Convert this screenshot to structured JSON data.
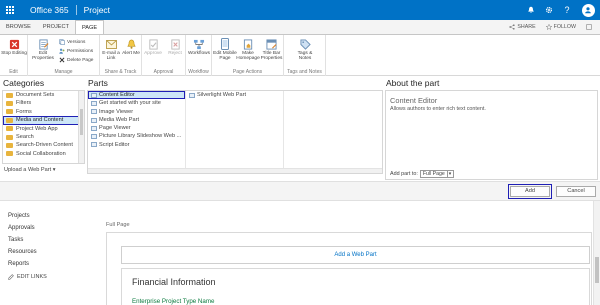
{
  "suite": {
    "brand": "Office 365",
    "app": "Project",
    "avatar_icon": "person-icon"
  },
  "ribbon_tabs": [
    {
      "label": "BROWSE"
    },
    {
      "label": "PROJECT"
    },
    {
      "label": "PAGE",
      "active": true
    }
  ],
  "tab_actions": {
    "share": "SHARE",
    "follow": "FOLLOW"
  },
  "ribbon": {
    "groups": {
      "edit": "Edit",
      "manage": "Manage",
      "share_track": "Share & Track",
      "approval": "Approval",
      "workflow": "Workflow",
      "page_actions": "Page Actions",
      "tags_notes": "Tags and Notes"
    },
    "buttons": {
      "stop_editing": "Stop Editing",
      "edit_properties": "Edit Properties",
      "versions": "Versions",
      "permissions": "Permissions",
      "delete_page": "Delete Page",
      "email_link": "E-mail a Link",
      "alert_me": "Alert Me",
      "approve": "Approve",
      "reject": "Reject",
      "workflows": "Workflows",
      "edit_mobile_page": "Edit Mobile Page",
      "make_homepage": "Make Homepage",
      "title_bar_properties": "Title Bar Properties",
      "tags_notes": "Tags & Notes"
    }
  },
  "adder": {
    "categories_title": "Categories",
    "parts_title": "Parts",
    "about_title": "About the part",
    "categories": [
      {
        "label": "Document Sets"
      },
      {
        "label": "Filters"
      },
      {
        "label": "Forms"
      },
      {
        "label": "Media and Content",
        "selected": true
      },
      {
        "label": "Project Web App"
      },
      {
        "label": "Search"
      },
      {
        "label": "Search-Driven Content"
      },
      {
        "label": "Social Collaboration"
      }
    ],
    "upload": "Upload a Web Part",
    "parts_col1": [
      {
        "label": "Content Editor",
        "selected": true
      },
      {
        "label": "Get started with your site"
      },
      {
        "label": "Image Viewer"
      },
      {
        "label": "Media Web Part"
      },
      {
        "label": "Page Viewer"
      },
      {
        "label": "Picture Library Slideshow Web ..."
      },
      {
        "label": "Script Editor"
      }
    ],
    "parts_col2": [
      {
        "label": "Silverlight Web Part"
      }
    ],
    "about": {
      "name": "Content Editor",
      "description": "Allows authors to enter rich text content.",
      "add_part_to": "Add part to:",
      "zone": "Full Page"
    },
    "add_button": "Add",
    "cancel_button": "Cancel"
  },
  "leftnav": {
    "items": [
      "Projects",
      "Approvals",
      "Tasks",
      "Resources",
      "Reports"
    ],
    "edit_links": "EDIT LINKS"
  },
  "page": {
    "zone_label": "Full Page",
    "add_web_part": "Add a Web Part",
    "section_title": "Financial Information",
    "section_field": "Enterprise Project Type Name"
  },
  "colors": {
    "suite_blue": "#0072c6",
    "highlight": "#1f1fb5",
    "selection": "#cde6f7"
  }
}
